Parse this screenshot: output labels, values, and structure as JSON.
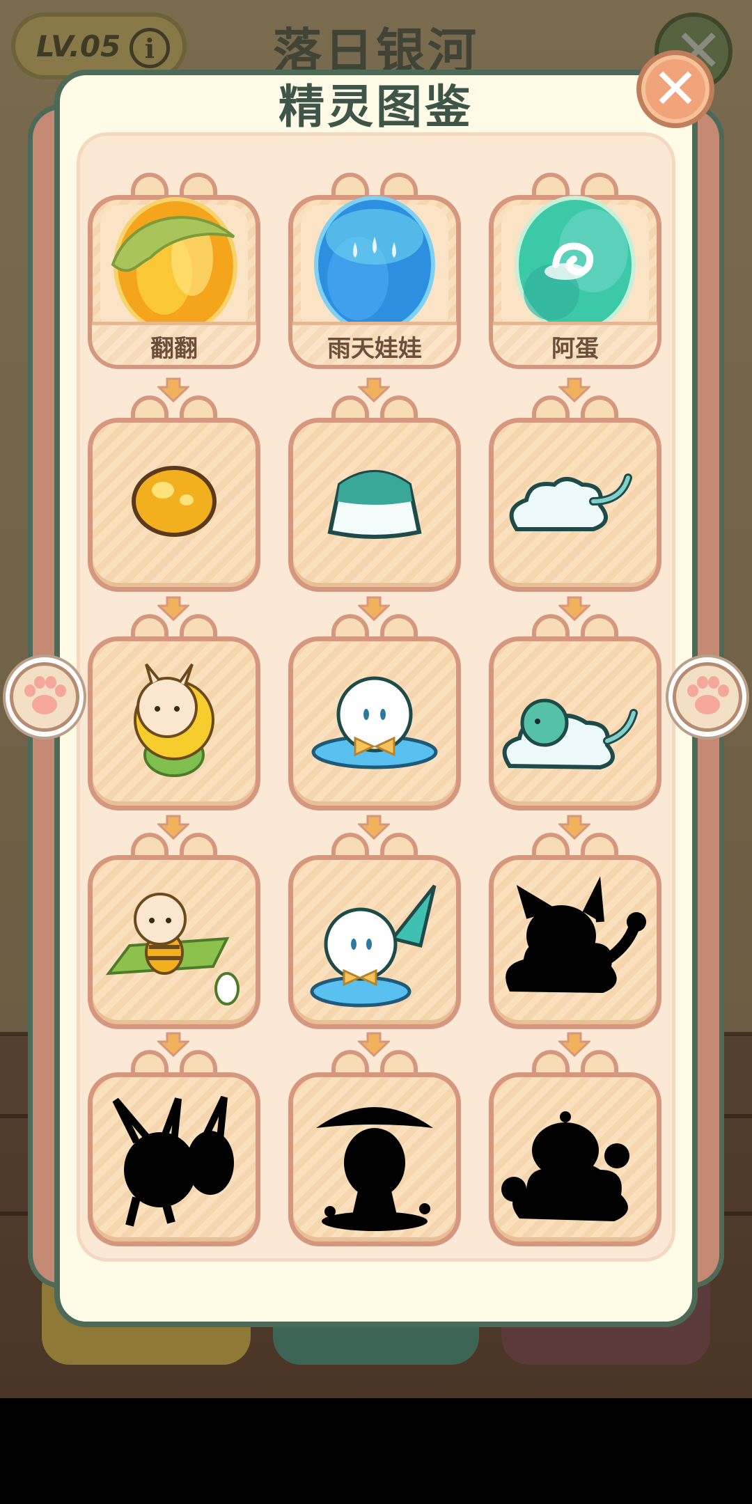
{
  "header": {
    "level": "LV.05",
    "info_icon": "info-icon",
    "background_title": "落日银河"
  },
  "modal": {
    "title": "精灵图鉴",
    "close_icon": "close-icon",
    "nav_left_icon": "paw-icon",
    "nav_right_icon": "paw-icon"
  },
  "dex": {
    "columns": [
      {
        "egg_name": "翻翻",
        "egg_icon": "yellow-leaf-egg-icon",
        "stages": [
          "golden-seed-icon",
          "corn-sprite-icon",
          "bee-sprite-on-leaf-icon",
          "locked-silhouette-icon"
        ]
      },
      {
        "egg_name": "雨天娃娃",
        "egg_icon": "blue-rain-egg-icon",
        "stages": [
          "teal-jelly-icon",
          "rain-doll-bowtie-icon",
          "rain-doll-umbrella-icon",
          "locked-silhouette-icon"
        ]
      },
      {
        "egg_name": "阿蛋",
        "egg_icon": "green-swirl-egg-icon",
        "stages": [
          "white-cloud-icon",
          "cloud-bird-icon",
          "locked-silhouette-icon",
          "locked-silhouette-icon"
        ]
      }
    ]
  },
  "colors": {
    "panel_border": "#4d6a58",
    "panel_fill": "#fffbe6",
    "card_border": "#d5977e",
    "close_fill": "#f1a37a"
  }
}
